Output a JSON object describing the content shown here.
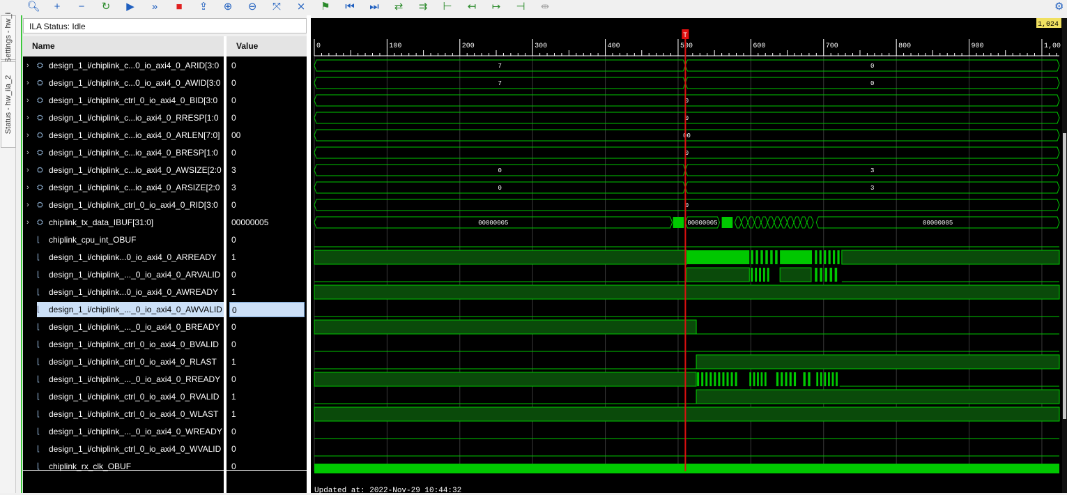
{
  "toolbar": {
    "items": [
      {
        "name": "search-icon",
        "glyph": "🔍︎"
      },
      {
        "name": "add-icon",
        "glyph": "+"
      },
      {
        "name": "remove-icon",
        "glyph": "−"
      },
      {
        "name": "refresh-icon",
        "glyph": "↻"
      },
      {
        "name": "run-trigger-icon",
        "glyph": "▶"
      },
      {
        "name": "run-immediate-icon",
        "glyph": "»"
      },
      {
        "name": "stop-icon",
        "glyph": "■"
      },
      {
        "name": "export-icon",
        "glyph": "⇪"
      },
      {
        "name": "zoom-in-icon",
        "glyph": "⊕"
      },
      {
        "name": "zoom-out-icon",
        "glyph": "⊖"
      },
      {
        "name": "zoom-fit-icon",
        "glyph": "⤧"
      },
      {
        "name": "cursor-icon",
        "glyph": "⨯"
      },
      {
        "name": "marker-icon",
        "glyph": "⚑"
      },
      {
        "name": "go-to-start-icon",
        "glyph": "⏮"
      },
      {
        "name": "go-to-end-icon",
        "glyph": "⏭"
      },
      {
        "name": "swap-icon",
        "glyph": "⇄"
      },
      {
        "name": "next-transition-icon",
        "glyph": "⇉"
      },
      {
        "name": "add-marker-icon",
        "glyph": "⊢"
      },
      {
        "name": "previous-marker-icon",
        "glyph": "↤"
      },
      {
        "name": "next-marker-icon",
        "glyph": "↦"
      },
      {
        "name": "delete-marker-icon",
        "glyph": "⊣"
      },
      {
        "name": "clear-markers-icon",
        "glyph": "⇹"
      }
    ],
    "settings_icon": "⚙"
  },
  "side_tabs": [
    "Settings - hw_i",
    "Status - hw_ila_2"
  ],
  "ila_status": "ILA Status:  Idle",
  "columns": {
    "name": "Name",
    "value": "Value"
  },
  "signals": [
    {
      "name": "design_1_i/chiplink_c...0_io_axi4_0_ARID[3:0",
      "value": "0",
      "bus": true,
      "selected": false
    },
    {
      "name": "design_1_i/chiplink_c...0_io_axi4_0_AWID[3:0",
      "value": "0",
      "bus": true,
      "selected": false
    },
    {
      "name": "design_1_i/chiplink_ctrl_0_io_axi4_0_BID[3:0",
      "value": "0",
      "bus": true,
      "selected": false
    },
    {
      "name": "design_1_i/chiplink_c...io_axi4_0_RRESP[1:0",
      "value": "0",
      "bus": true,
      "selected": false
    },
    {
      "name": "design_1_i/chiplink_c...io_axi4_0_ARLEN[7:0]",
      "value": "00",
      "bus": true,
      "selected": false
    },
    {
      "name": "design_1_i/chiplink_c...io_axi4_0_BRESP[1:0",
      "value": "0",
      "bus": true,
      "selected": false
    },
    {
      "name": "design_1_i/chiplink_c...io_axi4_0_AWSIZE[2:0",
      "value": "3",
      "bus": true,
      "selected": false
    },
    {
      "name": "design_1_i/chiplink_c...io_axi4_0_ARSIZE[2:0",
      "value": "3",
      "bus": true,
      "selected": false
    },
    {
      "name": "design_1_i/chiplink_ctrl_0_io_axi4_0_RID[3:0",
      "value": "0",
      "bus": true,
      "selected": false
    },
    {
      "name": "chiplink_tx_data_IBUF[31:0]",
      "value": "00000005",
      "bus": true,
      "selected": false
    },
    {
      "name": "chiplink_cpu_int_OBUF",
      "value": "0",
      "bus": false,
      "selected": false
    },
    {
      "name": "design_1_i/chiplink...0_io_axi4_0_ARREADY",
      "value": "1",
      "bus": false,
      "selected": false
    },
    {
      "name": "design_1_i/chiplink_..._0_io_axi4_0_ARVALID",
      "value": "0",
      "bus": false,
      "selected": false
    },
    {
      "name": "design_1_i/chiplink...0_io_axi4_0_AWREADY",
      "value": "1",
      "bus": false,
      "selected": false
    },
    {
      "name": "design_1_i/chiplink_..._0_io_axi4_0_AWVALID",
      "value": "0",
      "bus": false,
      "selected": true
    },
    {
      "name": "design_1_i/chiplink_..._0_io_axi4_0_BREADY",
      "value": "0",
      "bus": false,
      "selected": false
    },
    {
      "name": "design_1_i/chiplink_ctrl_0_io_axi4_0_BVALID",
      "value": "0",
      "bus": false,
      "selected": false
    },
    {
      "name": "design_1_i/chiplink_ctrl_0_io_axi4_0_RLAST",
      "value": "1",
      "bus": false,
      "selected": false
    },
    {
      "name": "design_1_i/chiplink_..._0_io_axi4_0_RREADY",
      "value": "0",
      "bus": false,
      "selected": false
    },
    {
      "name": "design_1_i/chiplink_ctrl_0_io_axi4_0_RVALID",
      "value": "1",
      "bus": false,
      "selected": false
    },
    {
      "name": "design_1_i/chiplink_ctrl_0_io_axi4_0_WLAST",
      "value": "1",
      "bus": false,
      "selected": false
    },
    {
      "name": "design_1_i/chiplink_..._0_io_axi4_0_WREADY",
      "value": "0",
      "bus": false,
      "selected": false
    },
    {
      "name": "design_1_i/chiplink_ctrl_0_io_axi4_0_WVALID",
      "value": "0",
      "bus": false,
      "selected": false
    },
    {
      "name": "chiplink_rx_clk_OBUF",
      "value": "0",
      "bus": false,
      "selected": false
    }
  ],
  "timeline": {
    "ticks": [
      "0",
      "100",
      "200",
      "300",
      "400",
      "500",
      "600",
      "700",
      "800",
      "900",
      "1,00"
    ],
    "end_label": "1,024",
    "trigger_marker": "T",
    "cursor_sample": 510,
    "max_sample": 1024,
    "wave_color": "#00c800"
  },
  "buses": {
    "ARID": {
      "before": "7",
      "after": "0"
    },
    "AWID": {
      "before": "7",
      "after": "0"
    },
    "BID": {
      "center": "0"
    },
    "RRESP": {
      "center": "0"
    },
    "ARLEN": {
      "center": "00"
    },
    "BRESP": {
      "center": "0"
    },
    "AWSIZE": {
      "before": "0",
      "after": "3"
    },
    "ARSIZE": {
      "before": "0",
      "after": "3"
    },
    "RID": {
      "center": "0"
    },
    "tx_data": {
      "left": "00000005",
      "mid": "00000005",
      "right": "00000005"
    }
  },
  "updated": "Updated at: 2022-Nov-29 10:44:32"
}
